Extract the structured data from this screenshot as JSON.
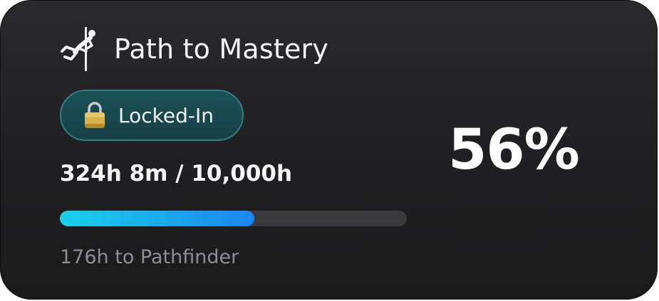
{
  "widget": {
    "title": "Path to Mastery",
    "title_icon": "pole-climber-icon",
    "status_badge": {
      "icon": "lock-icon",
      "label": "Locked-In"
    },
    "hours_text": "324h 8m / 10,000h",
    "progress": {
      "fraction": 0.56,
      "colors": {
        "track": "#3a3a3d",
        "fill_start": "#19d1e9",
        "fill_end": "#1b86f4"
      }
    },
    "next_milestone_text": "176h to Pathfinder",
    "percent_label": "56%"
  },
  "colors": {
    "card_background": "#1f1f21",
    "badge_background": "#1b5157",
    "badge_border": "#2f7f87",
    "primary_text": "#f5f5f7",
    "secondary_text": "#8d8d92"
  }
}
